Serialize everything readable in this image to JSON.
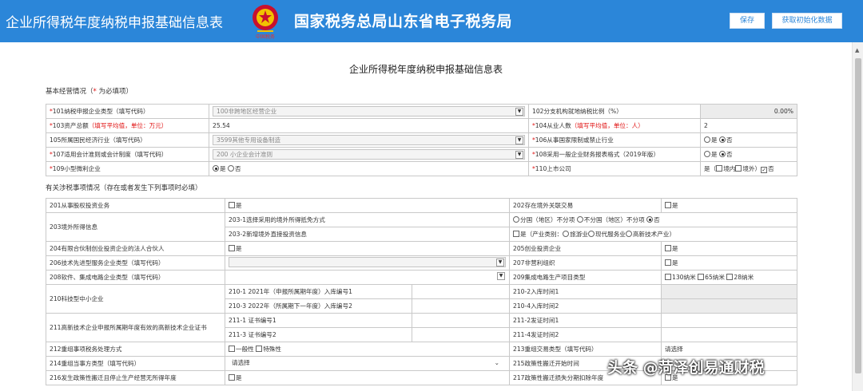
{
  "header": {
    "left_title": "企业所得税年度纳税申报基础信息表",
    "bureau": "国家税务总局山东省电子税务局",
    "emblem_text": "中国税务",
    "save_button": "保存",
    "init_button": "获取初始化数据"
  },
  "page_title": "企业所得税年度纳税申报基础信息表",
  "basic": {
    "section_prefix": "基本经营情况（",
    "section_star": "*",
    "section_suffix": " 为必填项）",
    "rows": [
      {
        "l_star": "*",
        "l_label": "101纳税申报企业类型（填写代码）",
        "l_value": "100非跨地区经营企业",
        "r_label": "102分支机构就地纳税比例（%）",
        "r_value": "0.00%"
      },
      {
        "l_star": "*",
        "l_label": "103资产总额",
        "l_hint": "（填写平均值，单位：万元）",
        "l_value": "25.54",
        "r_star": "*",
        "r_label": "104从业人数",
        "r_hint": "（填写平均值，单位：人）",
        "r_value": "2"
      },
      {
        "l_label": "105所属国民经济行业（填写代码）",
        "l_value": "3599其他专用设备制造",
        "r_star": "*",
        "r_label": "106从事国家限制或禁止行业",
        "yes": "是",
        "no": "否"
      },
      {
        "l_star": "*",
        "l_label": "107适用会计准则或会计制度（填写代码）",
        "l_value": "200 小企业会计准则",
        "r_star": "*",
        "r_label": "108采用一般企业财务报表格式（2019年版）",
        "yes": "是",
        "no": "否"
      },
      {
        "l_star": "*",
        "l_label": "109小型微利企业",
        "yes": "是",
        "no": "否",
        "r_star": "*",
        "r_label": "110上市公司",
        "r_text_a": "是（",
        "r_text_b": "境内",
        "r_text_c": "境外）",
        "r_text_d": "否"
      }
    ]
  },
  "matters": {
    "section": "有关涉税事项情况（存在或者发生下列事项时必填）",
    "r201": "201从事股权投资业务",
    "r202": "202存在境外关联交易",
    "yes": "是",
    "no": "否",
    "r203": "203境外所得信息",
    "r203_1": "203-1选择采用的境外所得抵免方式",
    "r203_1_opt1": "分国（地区）不分项",
    "r203_1_opt2": "不分国（地区）不分项",
    "r203_2": "203-2新增境外直接投资信息",
    "r203_2_a": "是（产业类别：",
    "r203_2_b": "旅游业",
    "r203_2_c": "现代服务业",
    "r203_2_d": "高新技术产业）",
    "r204": "204有限合伙制创业投资企业的法人合伙人",
    "r205": "205创业投资企业",
    "r206": "206技术先进型服务企业类型（填写代码）",
    "r207": "207非营利组织",
    "r208": "208软件、集成电路企业类型（填写代码）",
    "r209": "209集成电路生产项目类型",
    "r209_a": "130纳米",
    "r209_b": "65纳米",
    "r209_c": "28纳米",
    "r210": "210科技型中小企业",
    "r210_1": "210-1 2021年（申报所属期年度）入库编号1",
    "r210_2": "210-2入库时间1",
    "r210_3": "210-3 2022年（所属期下一年度）入库编号2",
    "r210_4": "210-4入库时间2",
    "r211": "211高新技术企业申报所属期年度有效的高新技术企业证书",
    "r211_1": "211-1 证书编号1",
    "r211_2": "211-2发证时间1",
    "r211_3": "211-3 证书编号2",
    "r211_4": "211-4发证时间2",
    "r212": "212重组事项税务处理方式",
    "r212_a": "一般性",
    "r212_b": "特殊性",
    "r213": "213重组交易类型（填写代码）",
    "r213_v": "请选择",
    "r214": "214重组当事方类型（填写代码）",
    "r214_v": "请选择",
    "r215": "215政策性搬迁开始时间",
    "r216": "216发生政策性搬迁且停止生产经营无所得年度",
    "r217": "217政策性搬迁损失分期扣除年度"
  },
  "watermark": "头条 @菏泽创易通财税",
  "colors": {
    "header_bg": "#2b86d9",
    "required": "#e01010"
  }
}
